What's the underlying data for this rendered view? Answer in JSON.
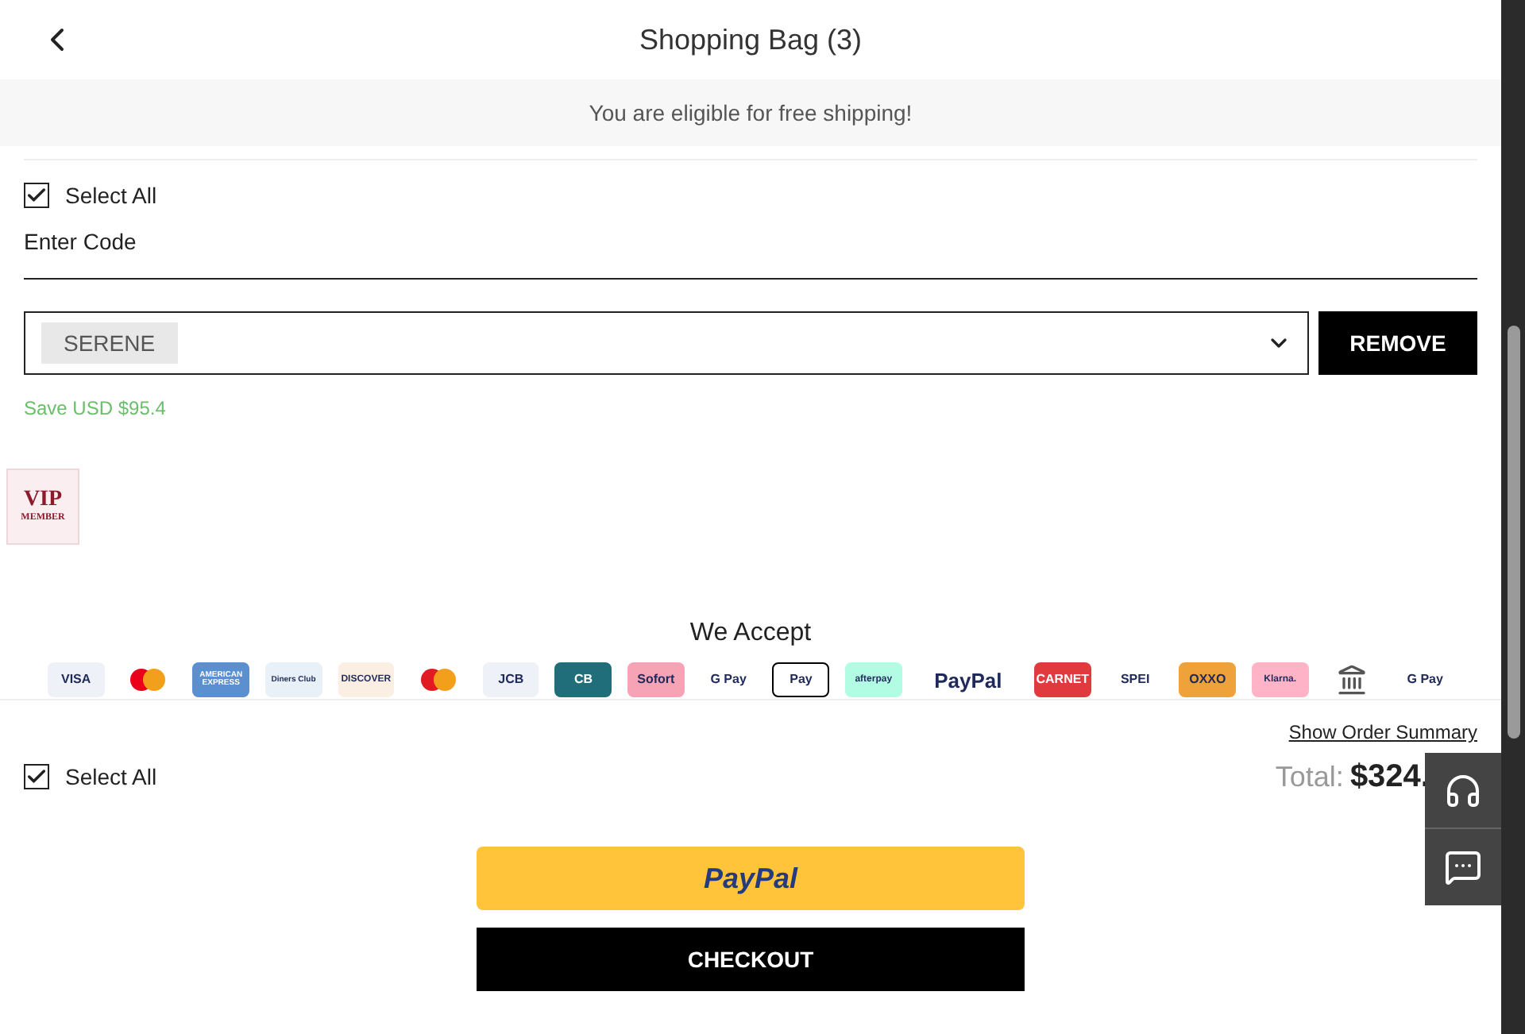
{
  "header": {
    "title": "Shopping Bag (3)"
  },
  "banner": "You are eligible for free shipping!",
  "select_all_top": {
    "label": "Select All",
    "checked": true
  },
  "coupon": {
    "label": "Enter Code",
    "code": "SERENE",
    "button": "REMOVE",
    "savings": "Save USD $95.4"
  },
  "vip_badge": {
    "title": "VIP",
    "subtitle": "MEMBER"
  },
  "payments": {
    "title": "We Accept",
    "logos": [
      {
        "kind": "text",
        "label": "VISA",
        "color": "#eef2f8"
      },
      {
        "kind": "circles",
        "color": "#eb001b"
      },
      {
        "kind": "text",
        "label": "AMERICAN EXPRESS",
        "color": "#5a8fd0"
      },
      {
        "kind": "text",
        "label": "Diners Club",
        "color": "#e8f0f8"
      },
      {
        "kind": "text",
        "label": "DISCOVER",
        "color": "#fbeee3"
      },
      {
        "kind": "circles",
        "color": "#e11b22"
      },
      {
        "kind": "text",
        "label": "JCB",
        "color": "#eef2f8"
      },
      {
        "kind": "text",
        "label": "CB",
        "color": "#1f6e7a"
      },
      {
        "kind": "text",
        "label": "Sofort",
        "color": "#f5a3b5"
      },
      {
        "kind": "text",
        "label": "G Pay",
        "color": "#ffffff"
      },
      {
        "kind": "outlined",
        "label": "Pay",
        "color": "#ffffff"
      },
      {
        "kind": "text",
        "label": "afterpay",
        "color": "#b2fce4"
      },
      {
        "kind": "wide",
        "label": "PayPal",
        "color": "#ffffff"
      },
      {
        "kind": "text",
        "label": "CARNET",
        "color": "#e03a3e"
      },
      {
        "kind": "text",
        "label": "SPEI",
        "color": "#ffffff"
      },
      {
        "kind": "text",
        "label": "OXXO",
        "color": "#f0a23a"
      },
      {
        "kind": "text",
        "label": "Klarna.",
        "color": "#ffb3c7"
      },
      {
        "kind": "bank",
        "color": "#ffffff"
      },
      {
        "kind": "text",
        "label": "G Pay",
        "color": "#ffffff"
      }
    ]
  },
  "footer": {
    "select_all": {
      "label": "Select All",
      "checked": true
    },
    "summary_link": "Show Order Summary",
    "total_label": "Total:",
    "total": "$324.",
    "paypal_button": "PayPal",
    "checkout_button": "CHECKOUT"
  }
}
